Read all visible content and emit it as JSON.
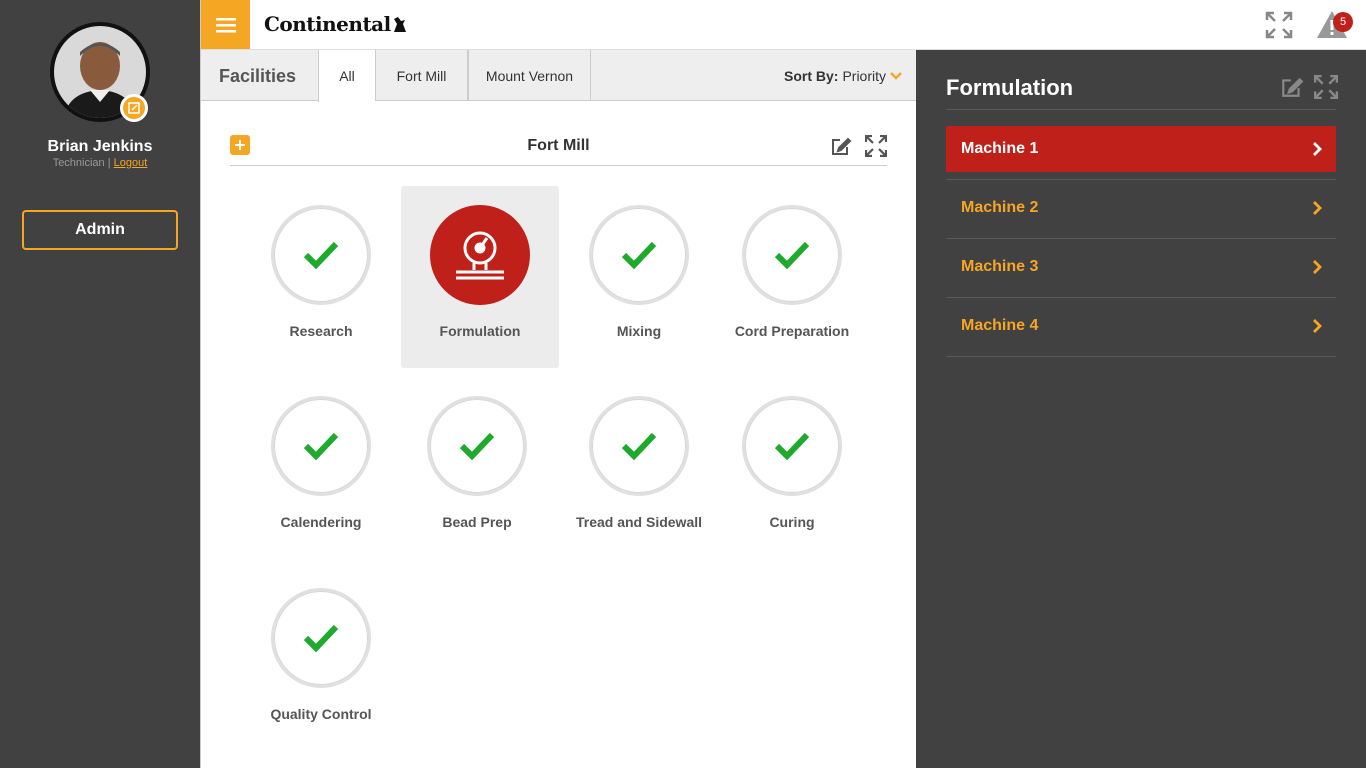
{
  "user": {
    "name": "Brian Jenkins",
    "role": "Technician",
    "separator": " | ",
    "logout_label": "Logout"
  },
  "admin_label": "Admin",
  "brand": "Continental",
  "alerts": {
    "count": "5"
  },
  "facilities": {
    "label": "Facilities",
    "tabs": [
      {
        "label": "All"
      },
      {
        "label": "Fort Mill"
      },
      {
        "label": "Mount Vernon"
      }
    ],
    "sort_label": "Sort By:",
    "sort_value": "Priority"
  },
  "section": {
    "title": "Fort Mill",
    "areas": [
      {
        "label": "Research",
        "status": "ok"
      },
      {
        "label": "Formulation",
        "status": "alert"
      },
      {
        "label": "Mixing",
        "status": "ok"
      },
      {
        "label": "Cord Preparation",
        "status": "ok"
      },
      {
        "label": "Calendering",
        "status": "ok"
      },
      {
        "label": "Bead Prep",
        "status": "ok"
      },
      {
        "label": "Tread and Sidewall",
        "status": "ok"
      },
      {
        "label": "Curing",
        "status": "ok"
      },
      {
        "label": "Quality Control",
        "status": "ok"
      }
    ]
  },
  "detail": {
    "title": "Formulation",
    "machines": [
      {
        "label": "Machine 1"
      },
      {
        "label": "Machine 2"
      },
      {
        "label": "Machine 3"
      },
      {
        "label": "Machine 4"
      }
    ]
  },
  "colors": {
    "accent": "#f5a623",
    "alert": "#c0201a",
    "ok": "#1faa2e",
    "sidebar": "#414141"
  }
}
